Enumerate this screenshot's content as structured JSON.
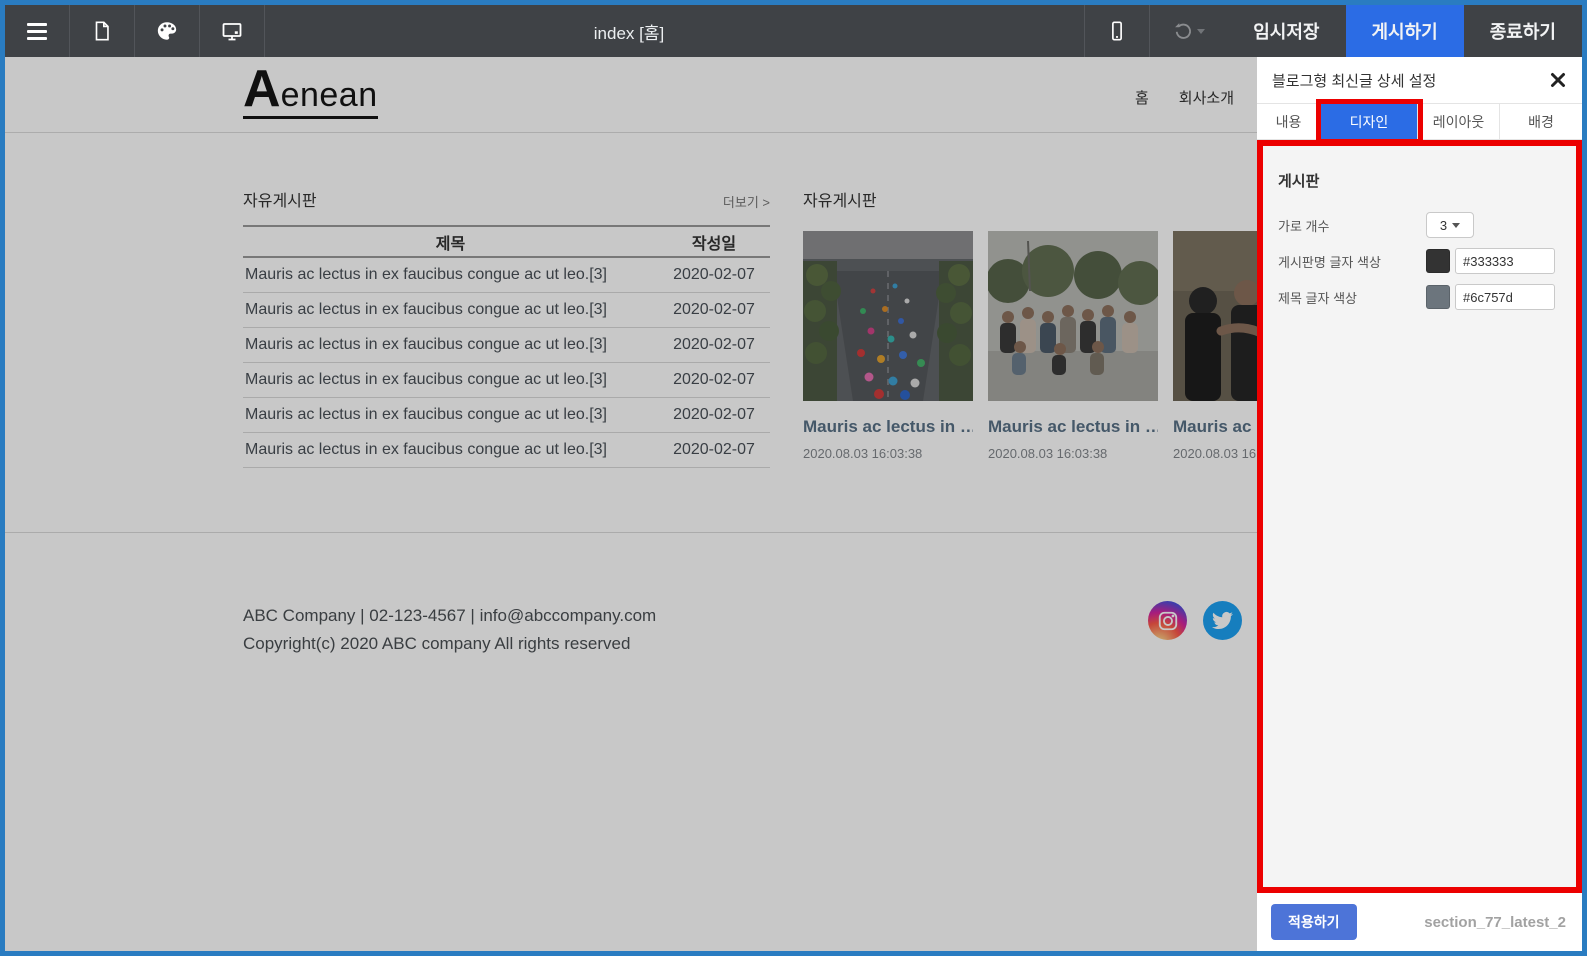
{
  "toolbar": {
    "title": "index [홈]",
    "temp_save_label": "임시저장",
    "publish_label": "게시하기",
    "exit_label": "종료하기",
    "publish_color": "#2b6ce5"
  },
  "site": {
    "logo_initial": "A",
    "logo_rest": "enean",
    "nav": [
      "홈",
      "회사소개"
    ],
    "board_list": {
      "title": "자유게시판",
      "more_label": "더보기 >",
      "columns": {
        "title": "제목",
        "date": "작성일"
      },
      "rows": [
        {
          "title": "Mauris ac lectus in ex faucibus congue ac ut leo.[3]",
          "date": "2020-02-07"
        },
        {
          "title": "Mauris ac lectus in ex faucibus congue ac ut leo.[3]",
          "date": "2020-02-07"
        },
        {
          "title": "Mauris ac lectus in ex faucibus congue ac ut leo.[3]",
          "date": "2020-02-07"
        },
        {
          "title": "Mauris ac lectus in ex faucibus congue ac ut leo.[3]",
          "date": "2020-02-07"
        },
        {
          "title": "Mauris ac lectus in ex faucibus congue ac ut leo.[3]",
          "date": "2020-02-07"
        },
        {
          "title": "Mauris ac lectus in ex faucibus congue ac ut leo.[3]",
          "date": "2020-02-07"
        }
      ]
    },
    "board_cards": {
      "title": "자유게시판",
      "cards": [
        {
          "title": "Mauris ac lectus in …",
          "date": "2020.08.03 16:03:38"
        },
        {
          "title": "Mauris ac lectus in …",
          "date": "2020.08.03 16:03:38"
        },
        {
          "title": "Mauris ac …",
          "date": "2020.08.03 16…"
        }
      ]
    },
    "footer": {
      "line1": "ABC Company | 02-123-4567 | info@abccompany.com",
      "line2": "Copyright(c) 2020 ABC company All rights reserved"
    }
  },
  "panel": {
    "title": "블로그형 최신글 상세 설정",
    "tabs": [
      {
        "label": "내용",
        "active": false
      },
      {
        "label": "디자인",
        "active": true
      },
      {
        "label": "레이아웃",
        "active": false
      },
      {
        "label": "배경",
        "active": false
      }
    ],
    "section_heading": "게시판",
    "fields": {
      "columns_label": "가로 개수",
      "columns_value": "3",
      "board_name_color_label": "게시판명 글자 색상",
      "board_name_color_value": "#333333",
      "title_color_label": "제목 글자 색상",
      "title_color_value": "#6c757d"
    },
    "apply_label": "적용하기",
    "section_id": "section_77_latest_2",
    "highlight_color": "#ec0000",
    "active_tab_color": "#2b6ce5"
  }
}
